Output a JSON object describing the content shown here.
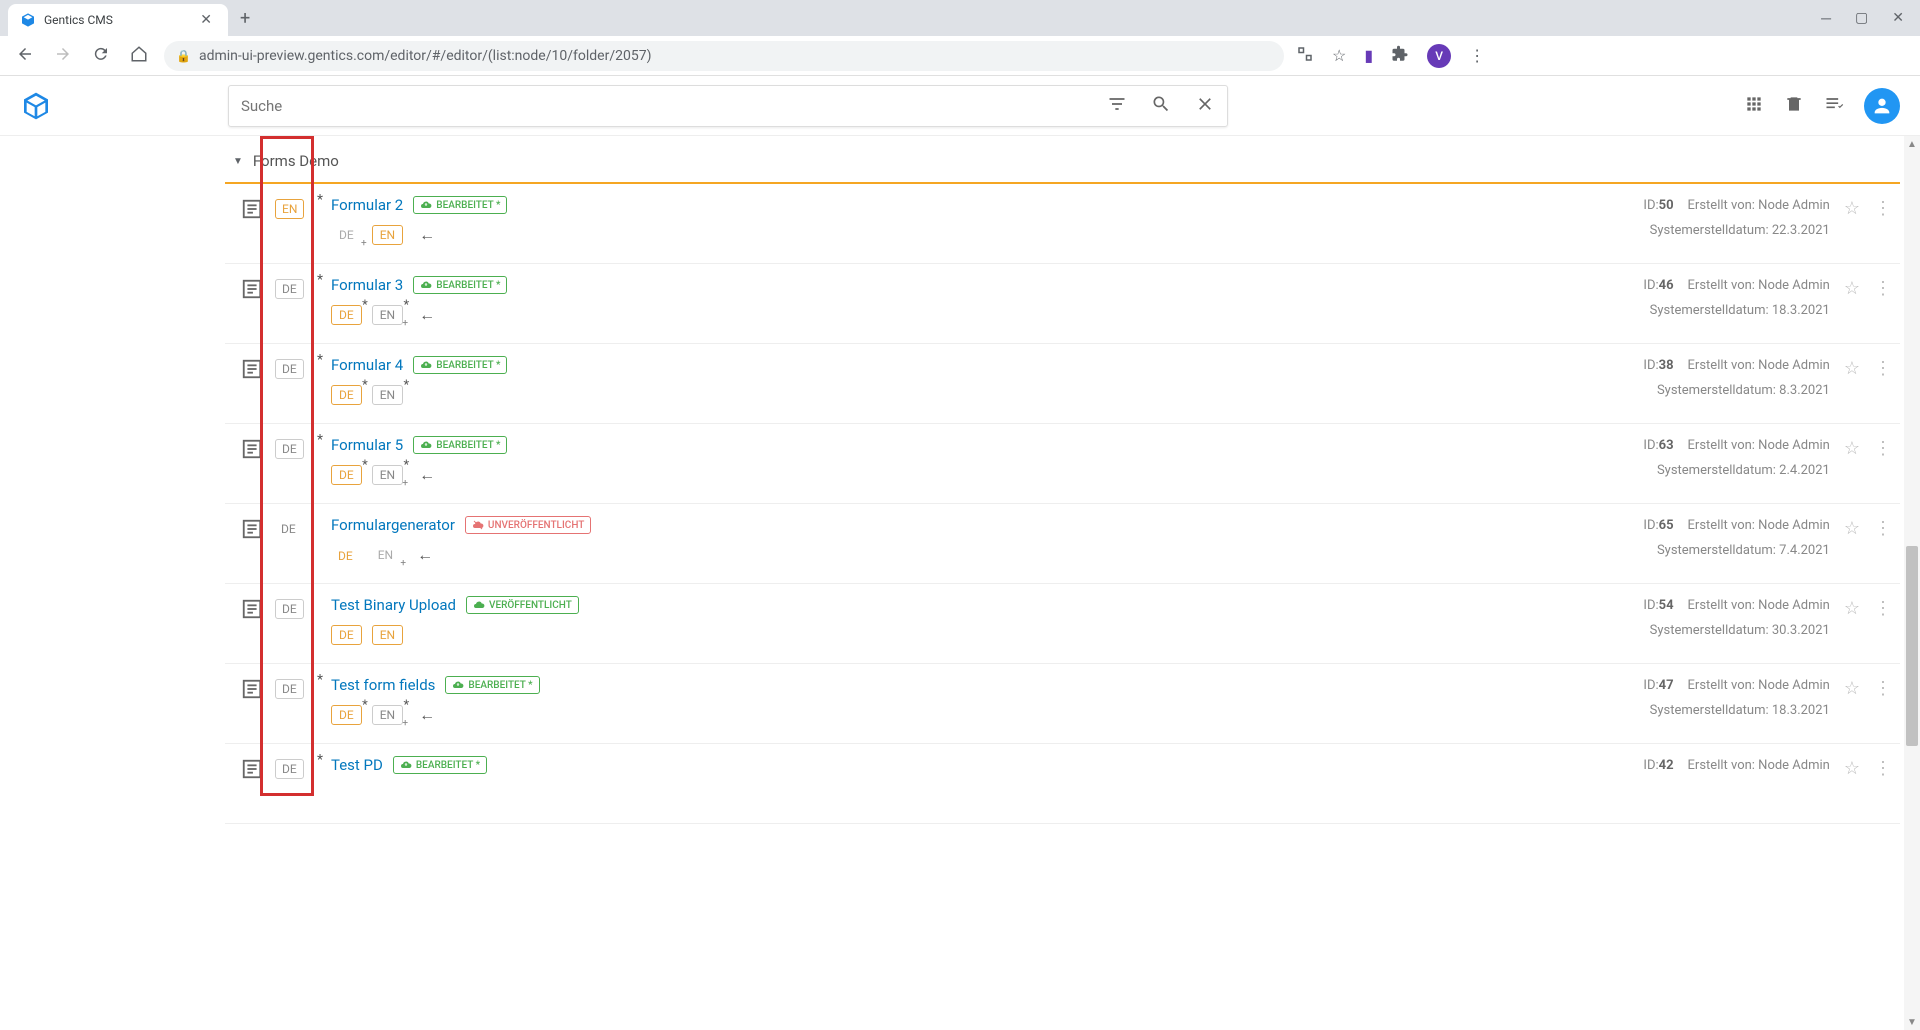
{
  "browser": {
    "tab_title": "Gentics CMS",
    "url": "admin-ui-preview.gentics.com/editor/#/editor/(list:node/10/folder/2057)",
    "avatar_letter": "V"
  },
  "header": {
    "search_placeholder": "Suche"
  },
  "breadcrumb": {
    "title": "Forms Demo"
  },
  "labels": {
    "id_prefix": "ID:",
    "created_by": "Erstellt von: ",
    "system_date": "Systemerstelldatum: "
  },
  "items": [
    {
      "main_lang": "EN",
      "main_active": true,
      "main_ast": true,
      "title": "Formular 2",
      "status": "BEARBEITET *",
      "status_type": "edited",
      "langs": [
        {
          "code": "DE",
          "style": "inactive",
          "ast": false,
          "plus": true
        },
        {
          "code": "EN",
          "style": "active",
          "ast": false,
          "plus": false
        }
      ],
      "has_back": true,
      "id": "50",
      "author": "Node Admin",
      "date": "22.3.2021"
    },
    {
      "main_lang": "DE",
      "main_active": false,
      "main_ast": true,
      "title": "Formular 3",
      "status": "BEARBEITET *",
      "status_type": "edited",
      "langs": [
        {
          "code": "DE",
          "style": "active",
          "ast": true,
          "plus": false
        },
        {
          "code": "EN",
          "style": "gray",
          "ast": true,
          "plus": true
        }
      ],
      "has_back": true,
      "id": "46",
      "author": "Node Admin",
      "date": "18.3.2021"
    },
    {
      "main_lang": "DE",
      "main_active": false,
      "main_ast": true,
      "title": "Formular 4",
      "status": "BEARBEITET *",
      "status_type": "edited",
      "langs": [
        {
          "code": "DE",
          "style": "active",
          "ast": true,
          "plus": false
        },
        {
          "code": "EN",
          "style": "gray",
          "ast": true,
          "plus": false
        }
      ],
      "has_back": false,
      "id": "38",
      "author": "Node Admin",
      "date": "8.3.2021"
    },
    {
      "main_lang": "DE",
      "main_active": false,
      "main_ast": true,
      "title": "Formular 5",
      "status": "BEARBEITET *",
      "status_type": "edited",
      "langs": [
        {
          "code": "DE",
          "style": "active",
          "ast": true,
          "plus": false
        },
        {
          "code": "EN",
          "style": "gray",
          "ast": true,
          "plus": true
        }
      ],
      "has_back": true,
      "id": "63",
      "author": "Node Admin",
      "date": "2.4.2021"
    },
    {
      "main_lang": "DE",
      "main_active": false,
      "main_ast": false,
      "main_noborder": true,
      "title": "Formulargenerator",
      "status": "UNVERÖFFENTLICHT",
      "status_type": "unpublished",
      "langs": [
        {
          "code": "DE",
          "style": "active_nb",
          "ast": false,
          "plus": false
        },
        {
          "code": "EN",
          "style": "inactive",
          "ast": false,
          "plus": true
        }
      ],
      "has_back": true,
      "id": "65",
      "author": "Node Admin",
      "date": "7.4.2021"
    },
    {
      "main_lang": "DE",
      "main_active": false,
      "main_ast": false,
      "title": "Test Binary Upload",
      "status": "VERÖFFENTLICHT",
      "status_type": "published",
      "langs": [
        {
          "code": "DE",
          "style": "active",
          "ast": false,
          "plus": false
        },
        {
          "code": "EN",
          "style": "active",
          "ast": false,
          "plus": false
        }
      ],
      "has_back": false,
      "id": "54",
      "author": "Node Admin",
      "date": "30.3.2021"
    },
    {
      "main_lang": "DE",
      "main_active": false,
      "main_ast": true,
      "title": "Test form fields",
      "status": "BEARBEITET *",
      "status_type": "edited",
      "langs": [
        {
          "code": "DE",
          "style": "active",
          "ast": true,
          "plus": false
        },
        {
          "code": "EN",
          "style": "gray",
          "ast": true,
          "plus": true
        }
      ],
      "has_back": true,
      "id": "47",
      "author": "Node Admin",
      "date": "18.3.2021"
    },
    {
      "main_lang": "DE",
      "main_active": false,
      "main_ast": true,
      "title": "Test PD",
      "status": "BEARBEITET *",
      "status_type": "edited",
      "langs": [],
      "has_back": false,
      "id": "42",
      "author": "Node Admin",
      "date": ""
    }
  ]
}
